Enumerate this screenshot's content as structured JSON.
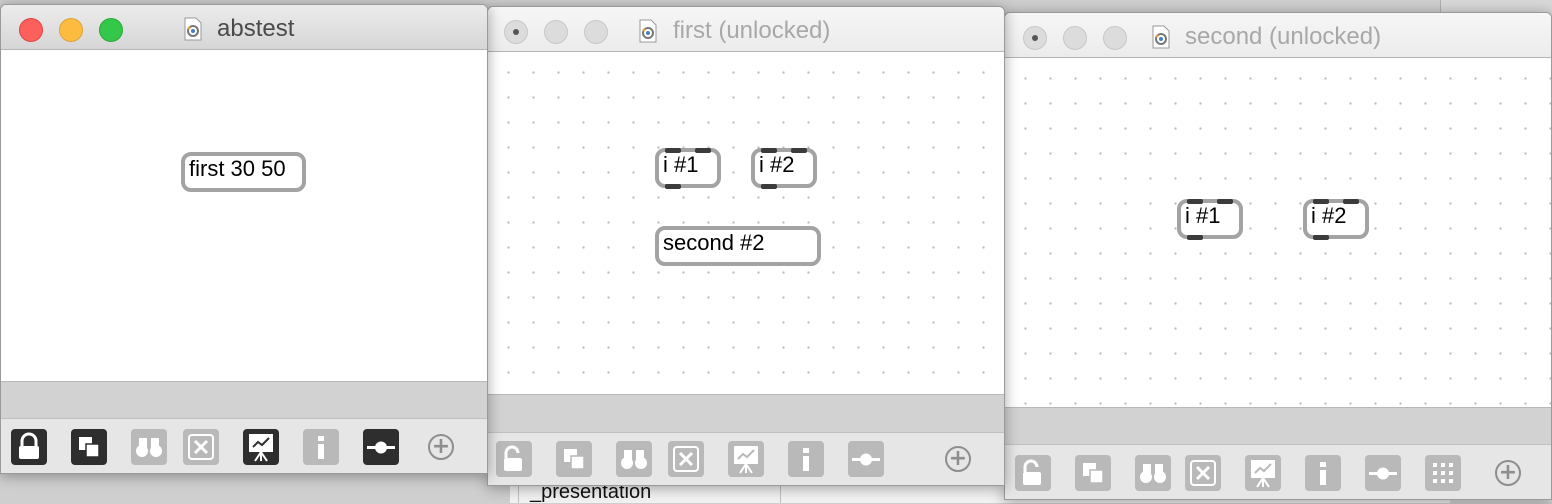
{
  "windows": {
    "abstest": {
      "title": "abstest",
      "objects": [
        {
          "text": "first 30 50"
        }
      ]
    },
    "first": {
      "title": "first (unlocked)",
      "objects": [
        {
          "text": "i #1"
        },
        {
          "text": "i #2"
        },
        {
          "text": "second #2"
        }
      ]
    },
    "second": {
      "title": "second (unlocked)",
      "objects": [
        {
          "text": "i #1"
        },
        {
          "text": "i #2"
        }
      ]
    }
  },
  "background": {
    "partial_text": "_presentation"
  },
  "toolbar_icons": [
    "lock-icon",
    "presentation-mode-icon",
    "binoculars-icon",
    "x-box-icon",
    "easel-icon",
    "info-icon",
    "slider-icon",
    "grid-icon",
    "plus-icon"
  ],
  "colors": {
    "close": "#fc605c",
    "minimize": "#fdbc40",
    "maximize": "#34c84a",
    "object_border": "#a3a3a3",
    "port": "#3b3b3b"
  }
}
